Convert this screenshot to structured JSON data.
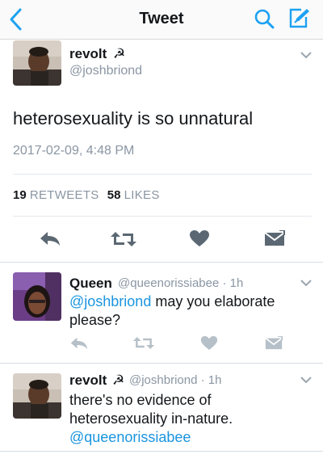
{
  "navbar": {
    "title": "Tweet",
    "icons": [
      "back-chevron-icon",
      "search-icon",
      "compose-icon"
    ]
  },
  "main_tweet": {
    "name": "revolt",
    "name_emoji": "☭",
    "handle": "@joshbriond",
    "text": "heterosexuality is so unnatural",
    "timestamp": "2017-02-09, 4:48 PM",
    "retweets_count": "19",
    "retweets_label": "RETWEETS",
    "likes_count": "58",
    "likes_label": "LIKES"
  },
  "replies": [
    {
      "name": "Queen",
      "handle": "@queenorissiabee",
      "time": "· 1h",
      "mention": "@joshbriond",
      "text": "may you elaborate please?"
    },
    {
      "name": "revolt",
      "name_emoji": "☭",
      "handle": "@joshbriond",
      "time": "· 1h",
      "text_line1": "there's no evidence of",
      "text_line2": "heterosexuality in-nature.",
      "mention": "@queenorissiabee"
    }
  ],
  "colors": {
    "link": "#1b95e0",
    "secondary_text": "#8a96a3",
    "action_icon_main": "#5b6873",
    "action_icon_reply": "#b6c0c8"
  }
}
